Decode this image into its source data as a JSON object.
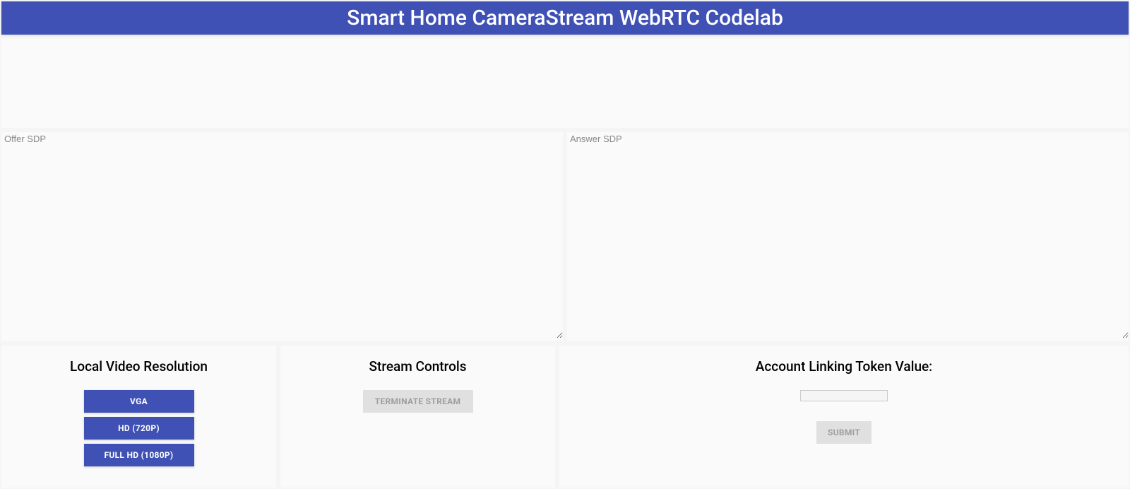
{
  "header": {
    "title": "Smart Home CameraStream WebRTC Codelab"
  },
  "sdp": {
    "offer_placeholder": "Offer SDP",
    "answer_placeholder": "Answer SDP",
    "offer_value": "",
    "answer_value": ""
  },
  "panels": {
    "resolution": {
      "heading": "Local Video Resolution",
      "buttons": {
        "vga": "VGA",
        "hd": "HD (720P)",
        "fullhd": "FULL HD (1080P)"
      }
    },
    "stream": {
      "heading": "Stream Controls",
      "terminate": "TERMINATE STREAM"
    },
    "account": {
      "heading": "Account Linking Token Value:",
      "token_value": "",
      "submit": "SUBMIT"
    }
  }
}
